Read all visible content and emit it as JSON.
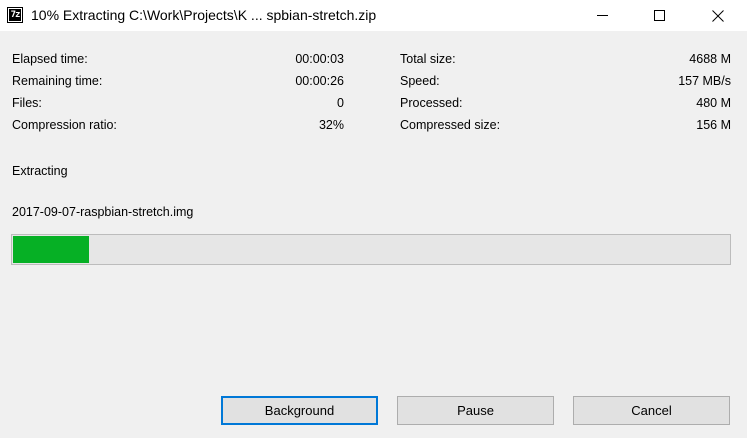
{
  "window": {
    "title": "10% Extracting C:\\Work\\Projects\\K ... spbian-stretch.zip",
    "icon_text": "7z"
  },
  "stats_left": [
    {
      "label": "Elapsed time:",
      "value": "00:00:03"
    },
    {
      "label": "Remaining time:",
      "value": "00:00:26"
    },
    {
      "label": "Files:",
      "value": "0"
    },
    {
      "label": "Compression ratio:",
      "value": "32%"
    }
  ],
  "stats_right": [
    {
      "label": "Total size:",
      "value": "4688 M"
    },
    {
      "label": "Speed:",
      "value": "157 MB/s"
    },
    {
      "label": "Processed:",
      "value": "480 M"
    },
    {
      "label": "Compressed size:",
      "value": "156 M"
    }
  ],
  "status": {
    "operation": "Extracting",
    "current_file": "2017-09-07-raspbian-stretch.img",
    "progress_percent": 10,
    "progress_color": "#06b025"
  },
  "buttons": {
    "background": "Background",
    "pause": "Pause",
    "cancel": "Cancel"
  },
  "icons": {
    "app": "7zip-icon",
    "minimize": "minimize-icon",
    "maximize": "maximize-icon",
    "close": "close-icon"
  }
}
